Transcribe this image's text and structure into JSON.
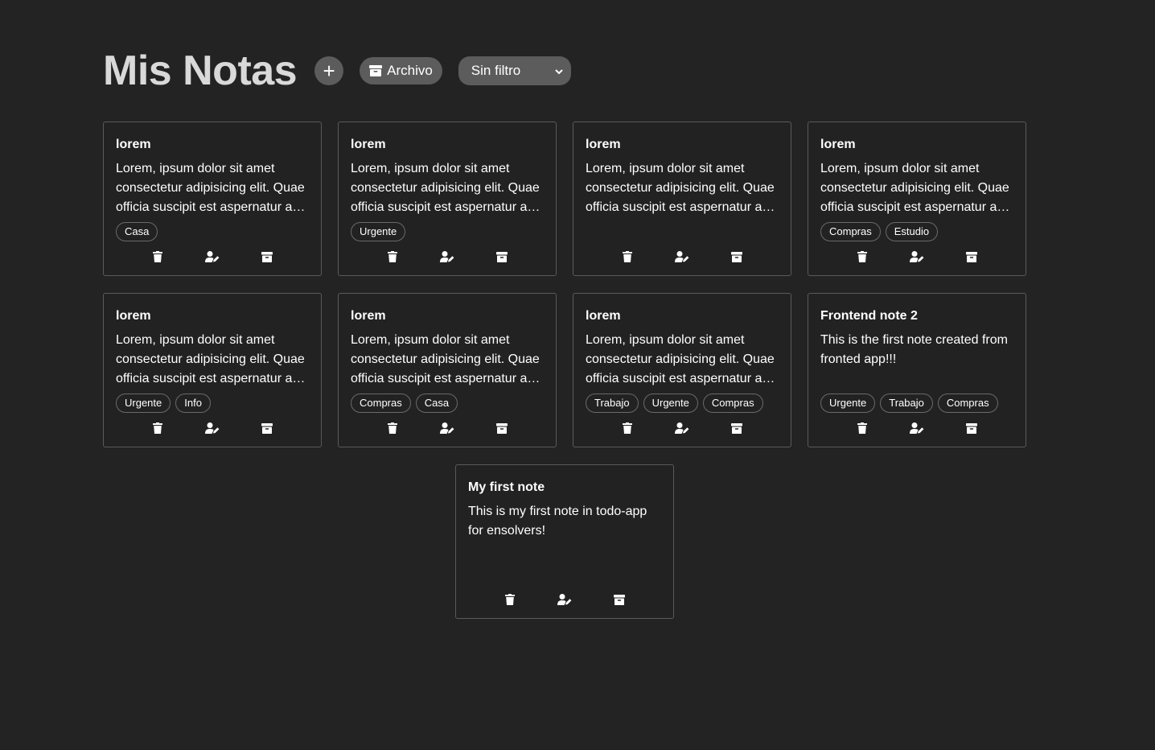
{
  "header": {
    "title": "Mis Notas",
    "add_label": "+",
    "archive_label": "Archivo",
    "filter_value": "Sin filtro"
  },
  "notes": [
    {
      "title": "lorem",
      "body": "Lorem, ipsum dolor sit amet consectetur adipisicing elit. Quae officia suscipit est aspernatur a…",
      "tags": [
        "Casa"
      ]
    },
    {
      "title": "lorem",
      "body": "Lorem, ipsum dolor sit amet consectetur adipisicing elit. Quae officia suscipit est aspernatur a…",
      "tags": [
        "Urgente"
      ]
    },
    {
      "title": "lorem",
      "body": "Lorem, ipsum dolor sit amet consectetur adipisicing elit. Quae officia suscipit est aspernatur a…",
      "tags": []
    },
    {
      "title": "lorem",
      "body": "Lorem, ipsum dolor sit amet consectetur adipisicing elit. Quae officia suscipit est aspernatur a…",
      "tags": [
        "Compras",
        "Estudio"
      ]
    },
    {
      "title": "lorem",
      "body": "Lorem, ipsum dolor sit amet consectetur adipisicing elit. Quae officia suscipit est aspernatur a…",
      "tags": [
        "Urgente",
        "Info"
      ]
    },
    {
      "title": "lorem",
      "body": "Lorem, ipsum dolor sit amet consectetur adipisicing elit. Quae officia suscipit est aspernatur a…",
      "tags": [
        "Compras",
        "Casa"
      ]
    },
    {
      "title": "lorem",
      "body": "Lorem, ipsum dolor sit amet consectetur adipisicing elit. Quae officia suscipit est aspernatur a…",
      "tags": [
        "Trabajo",
        "Urgente",
        "Compras"
      ]
    },
    {
      "title": "Frontend note 2",
      "body": "This is the first note created from fronted app!!!",
      "tags": [
        "Urgente",
        "Trabajo",
        "Compras"
      ]
    },
    {
      "title": "My first note",
      "body": "This is my first note in todo-app for ensolvers!",
      "tags": []
    }
  ],
  "icons": {
    "delete": "trash-icon",
    "edit": "user-edit-icon",
    "archive": "archive-icon"
  },
  "colors": {
    "background": "#232323",
    "button": "#5c5c5c",
    "card_border": "#5a5a5a"
  }
}
